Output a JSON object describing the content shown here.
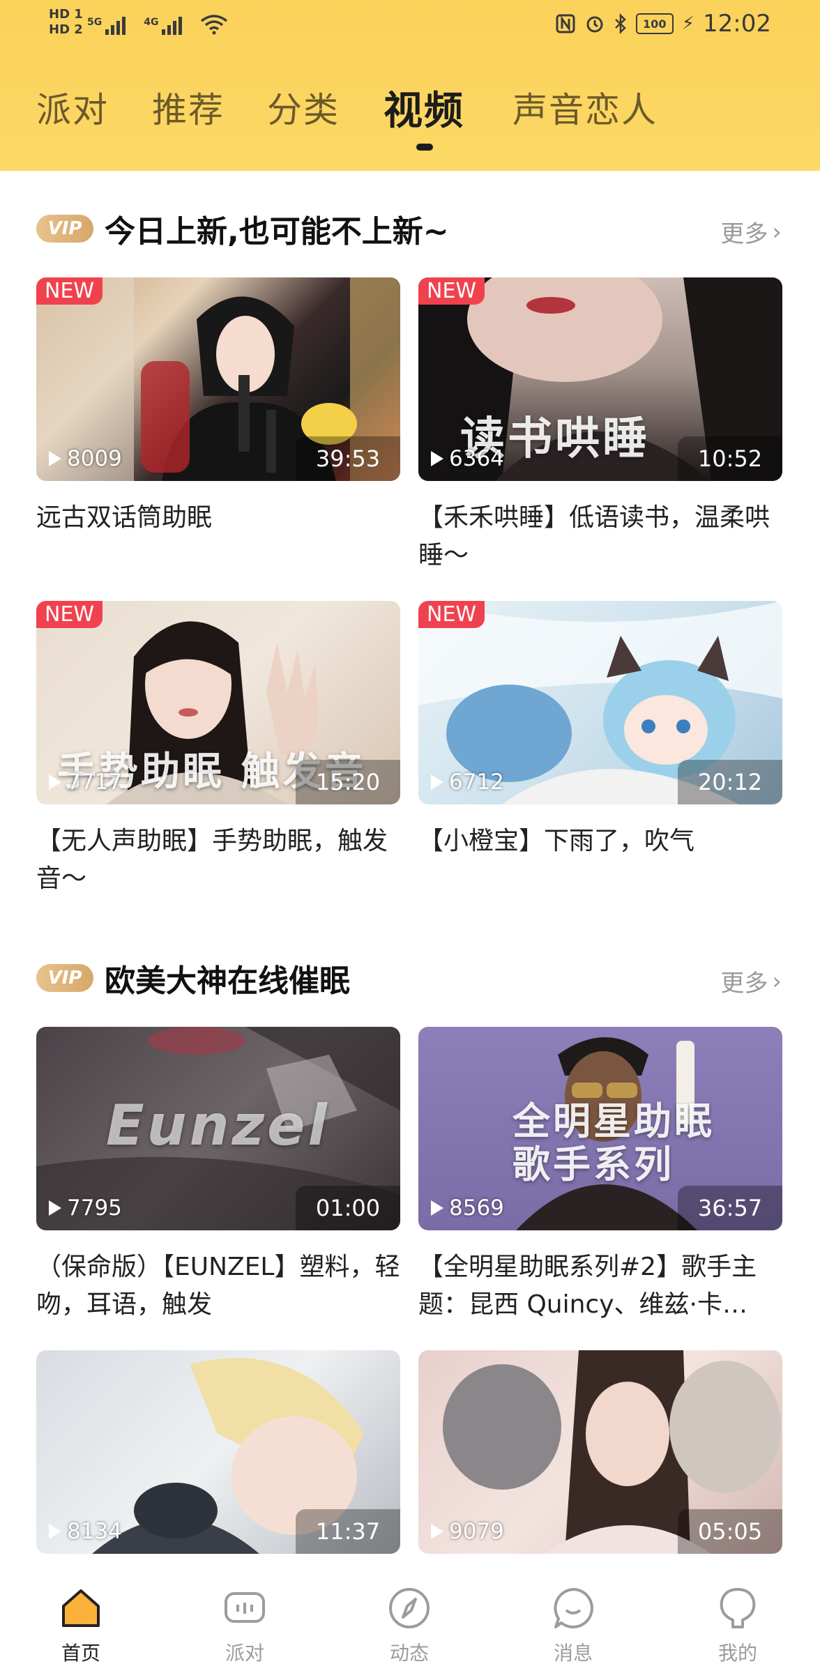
{
  "status_bar": {
    "sim1": "HD 1",
    "sim2": "HD 2",
    "net1": "5G",
    "net2": "4G",
    "battery": "100",
    "time": "12:02"
  },
  "tabs": [
    {
      "label": "派对"
    },
    {
      "label": "推荐"
    },
    {
      "label": "分类"
    },
    {
      "label": "视频",
      "active": true
    },
    {
      "label": "声音恋人"
    }
  ],
  "sections": [
    {
      "vip_badge": "VIP",
      "title": "今日上新,也可能不上新~",
      "more": "更多",
      "items": [
        {
          "new": "NEW",
          "views": "8009",
          "duration": "39:53",
          "caption": "远古双话筒助眠"
        },
        {
          "new": "NEW",
          "views": "6364",
          "duration": "10:52",
          "caption": "【禾禾哄睡】低语读书，温柔哄睡～",
          "overlay": "读书哄睡"
        },
        {
          "new": "NEW",
          "views": "7717",
          "duration": "15:20",
          "caption": "【无人声助眠】手势助眠，触发音～",
          "overlay": "手势助眠 触发音"
        },
        {
          "new": "NEW",
          "views": "6712",
          "duration": "20:12",
          "caption": "【小橙宝】下雨了，吹气"
        }
      ]
    },
    {
      "vip_badge": "VIP",
      "title": "欧美大神在线催眠",
      "more": "更多",
      "items": [
        {
          "views": "7795",
          "duration": "01:00",
          "caption": "（保命版）【EUNZEL】塑料，轻吻，耳语，触发",
          "overlay": "Eunzel"
        },
        {
          "views": "8569",
          "duration": "36:57",
          "caption": "【全明星助眠系列#2】歌手主题：昆西 Quincy、维兹·卡…",
          "overlay": "全明星助眠\n歌手系列"
        },
        {
          "views": "8134",
          "duration": "11:37",
          "caption": ""
        },
        {
          "views": "9079",
          "duration": "05:05",
          "caption": ""
        }
      ]
    }
  ],
  "bottom_nav": [
    {
      "label": "首页",
      "icon": "home-icon",
      "active": true
    },
    {
      "label": "派对",
      "icon": "party-icon"
    },
    {
      "label": "动态",
      "icon": "compass-icon"
    },
    {
      "label": "消息",
      "icon": "message-icon"
    },
    {
      "label": "我的",
      "icon": "profile-icon"
    }
  ],
  "colors": {
    "header": "#fcd563",
    "new_badge": "#f0424e",
    "vip": "#dcb277",
    "active_nav": "#fbb23a"
  }
}
